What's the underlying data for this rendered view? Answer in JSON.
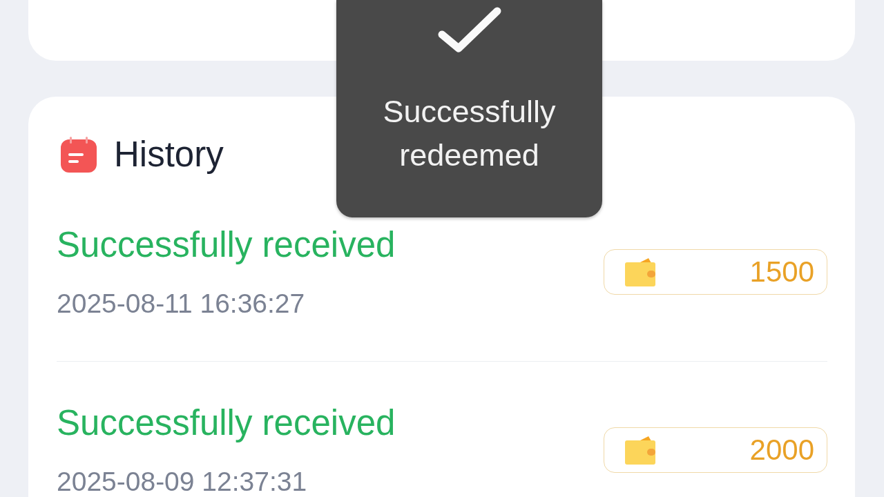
{
  "toast": {
    "message": "Successfully redeemed"
  },
  "history": {
    "title": "History",
    "records": [
      {
        "status": "Successfully received",
        "time": "2025-08-11 16:36:27",
        "amount": "1500"
      },
      {
        "status": "Successfully received",
        "time": "2025-08-09 12:37:31",
        "amount": "2000"
      }
    ]
  }
}
